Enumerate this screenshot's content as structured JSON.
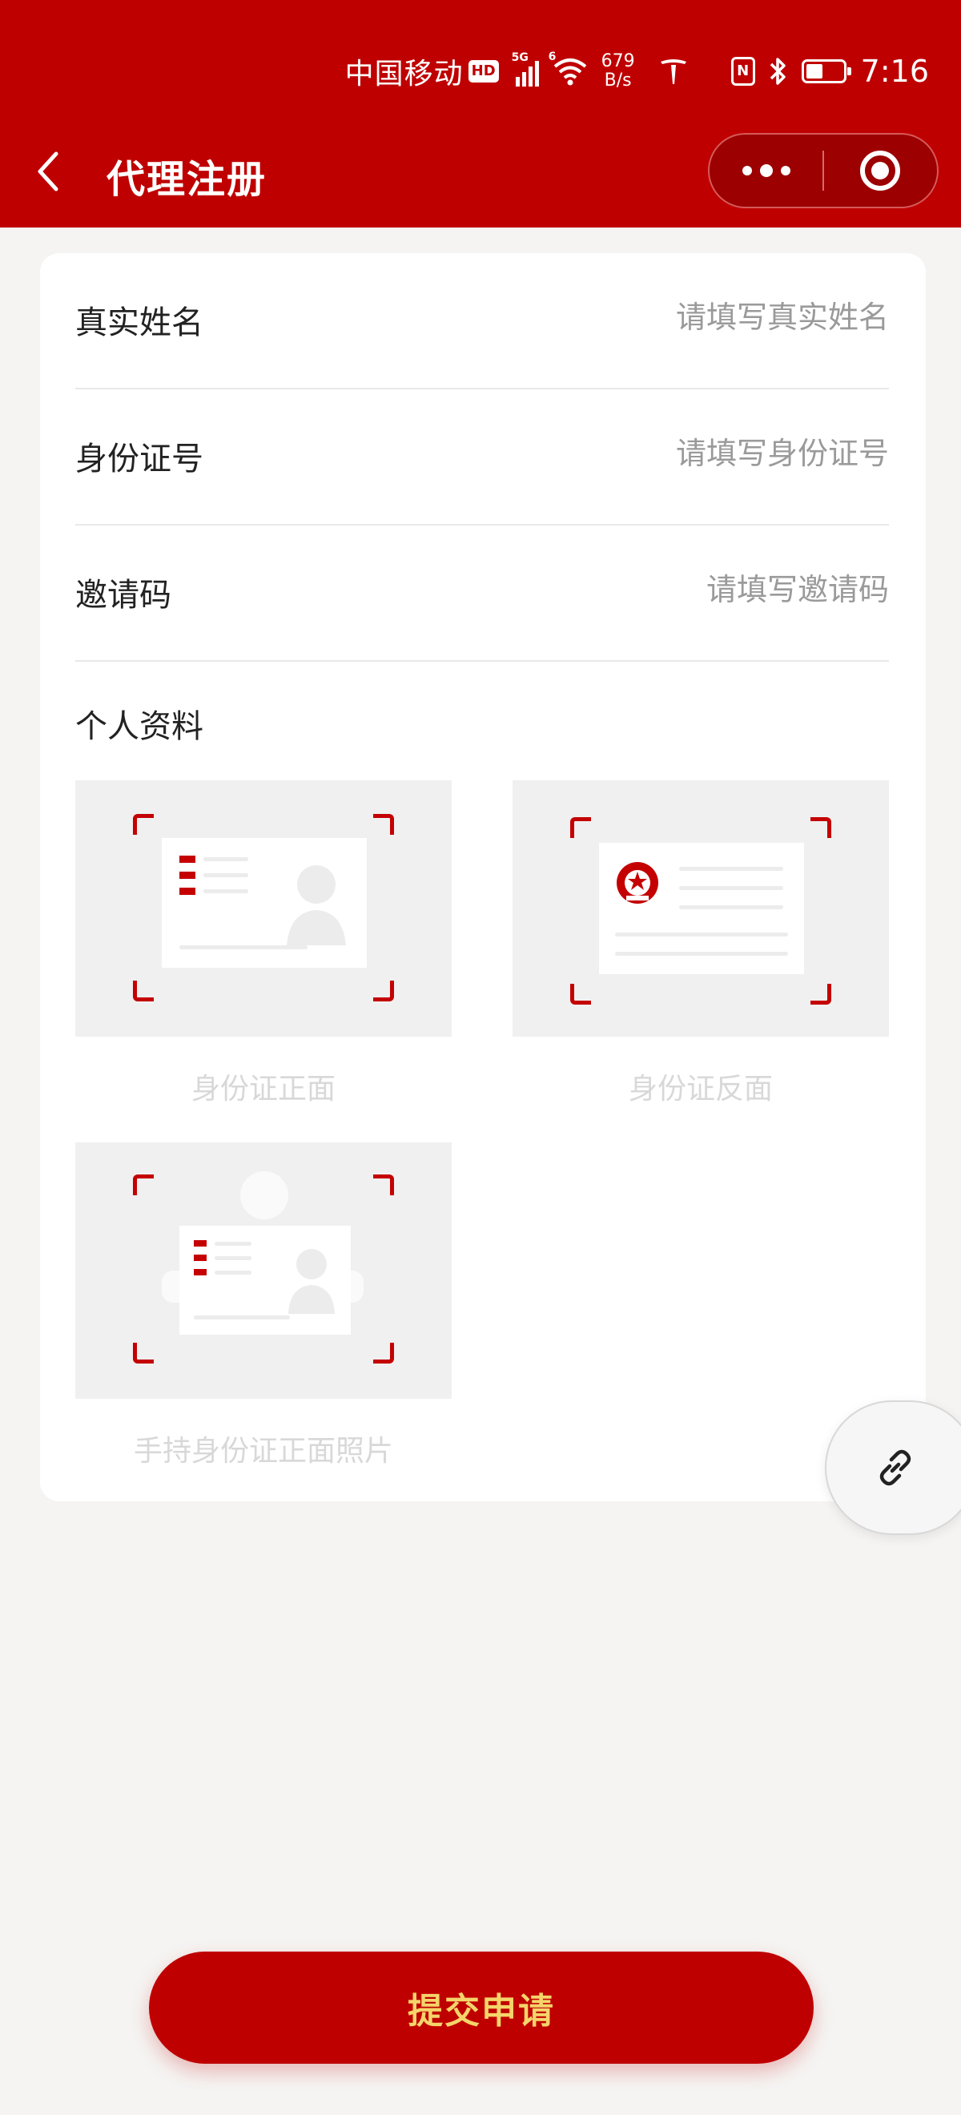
{
  "status_bar": {
    "carrier": "中国移动",
    "hd": "HD",
    "signal_label": "5G",
    "wifi_label": "6",
    "speed_value": "679",
    "speed_unit": "B/s",
    "nfc": "N",
    "time": "7:16"
  },
  "nav": {
    "title": "代理注册"
  },
  "form": {
    "name_label": "真实姓名",
    "name_placeholder": "请填写真实姓名",
    "id_label": "身份证号",
    "id_placeholder": "请填写身份证号",
    "invite_label": "邀请码",
    "invite_placeholder": "请填写邀请码"
  },
  "profile": {
    "section_title": "个人资料",
    "uploads": [
      {
        "caption": "身份证正面"
      },
      {
        "caption": "身份证反面"
      },
      {
        "caption": "手持身份证正面照片"
      }
    ]
  },
  "submit_label": "提交申请",
  "colors": {
    "brand_red": "#bf0000",
    "submit_text": "#f5d46a"
  },
  "icons": [
    "back-arrow-icon",
    "more-dots-icon",
    "close-target-icon",
    "link-icon",
    "id-front-icon",
    "id-back-icon",
    "id-handheld-icon"
  ]
}
